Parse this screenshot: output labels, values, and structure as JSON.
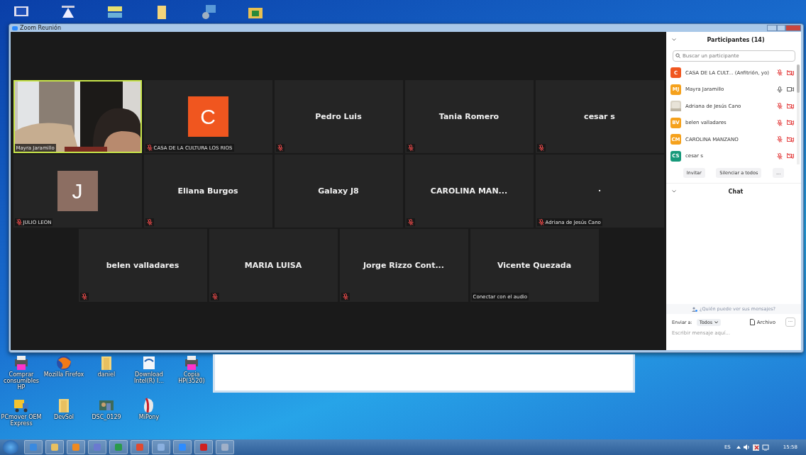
{
  "window": {
    "title": "Zoom Reunión"
  },
  "video_rows": [
    {
      "tiles": [
        {
          "kind": "video",
          "label": "Mayra Jaramillo",
          "muted": false,
          "active": true
        },
        {
          "kind": "avatar",
          "letter": "C",
          "color": "#f0561f",
          "label": "CASA DE LA CULTURA LOS RIOS",
          "muted": true,
          "active": false
        },
        {
          "kind": "name",
          "name": "Pedro Luis",
          "muted": true,
          "active": false
        },
        {
          "kind": "name",
          "name": "Tania Romero",
          "muted": true,
          "active": false
        },
        {
          "kind": "name",
          "name": "cesar s",
          "muted": true,
          "active": false
        }
      ]
    },
    {
      "tiles": [
        {
          "kind": "avatar",
          "letter": "J",
          "color": "#8c6e62",
          "label": "JULIO LEON",
          "muted": true,
          "active": false
        },
        {
          "kind": "name",
          "name": "Eliana Burgos",
          "muted": true,
          "active": false
        },
        {
          "kind": "name",
          "name": "Galaxy J8",
          "muted": false,
          "active": false
        },
        {
          "kind": "name",
          "name": "CAROLINA MAN...",
          "muted": true,
          "active": false
        },
        {
          "kind": "name",
          "name": "·",
          "label": "Adriana de Jesús Cano",
          "muted": true,
          "active": false
        }
      ]
    },
    {
      "tiles": [
        {
          "kind": "name",
          "name": "belen valladares",
          "muted": true,
          "active": false
        },
        {
          "kind": "name",
          "name": "MARIA LUISA",
          "muted": true,
          "active": false
        },
        {
          "kind": "name",
          "name": "Jorge Rizzo Cont...",
          "muted": true,
          "active": false
        },
        {
          "kind": "name",
          "name": "Vicente Quezada",
          "label": "Conectar con el audio",
          "muted": false,
          "active": false
        }
      ]
    }
  ],
  "participants_panel": {
    "title": "Participantes (14)",
    "search": {
      "placeholder": "Buscar un participante"
    },
    "participants": [
      {
        "kind": "initials",
        "initials": "C",
        "color": "#f0561f",
        "name": "CASA DE LA CULT... (Anfitrión, yo)",
        "muted": true,
        "video_off": true
      },
      {
        "kind": "initials",
        "initials": "MJ",
        "color": "#f5a11c",
        "name": "Mayra Jaramillo",
        "muted": false,
        "video_off": false
      },
      {
        "kind": "picture",
        "name": "Adriana de Jesús Cano",
        "muted": true,
        "video_off": true
      },
      {
        "kind": "initials",
        "initials": "BV",
        "color": "#f5a11c",
        "name": "belen valladares",
        "muted": true,
        "video_off": true
      },
      {
        "kind": "initials",
        "initials": "CM",
        "color": "#f5a11c",
        "name": "CAROLINA MANZANO",
        "muted": true,
        "video_off": true
      },
      {
        "kind": "initials",
        "initials": "CS",
        "color": "#17997a",
        "name": "cesar s",
        "muted": true,
        "video_off": true
      }
    ],
    "buttons": [
      "Invitar",
      "Silenciar a todos",
      "..."
    ]
  },
  "chat_panel": {
    "title": "Chat",
    "privacy_note": "¿Quién puede ver sus mensajes?",
    "send_to_label": "Enviar a:",
    "send_to": "Todos",
    "file_button": "Archivo",
    "more_button": "···",
    "message": {
      "placeholder": "Escribir mensaje aquí..."
    }
  },
  "desktop_icons": [
    {
      "label": "Comprar consumibles HP",
      "kind": "printer"
    },
    {
      "label": "Mozilla Firefox",
      "kind": "globe"
    },
    {
      "label": "daniel",
      "kind": "folder"
    },
    {
      "label": "Download Intel(R) I...",
      "kind": "box"
    },
    {
      "label": "Copia HP(3520)",
      "kind": "printer"
    },
    {
      "label": "PCmover OEM Express",
      "kind": "truck"
    },
    {
      "label": "DevSol",
      "kind": "folder"
    },
    {
      "label": "DSC_0129"
    },
    {
      "label": "MiPony",
      "kind": "mouse"
    }
  ],
  "tray": {
    "language": "ES",
    "time": "15:58"
  }
}
